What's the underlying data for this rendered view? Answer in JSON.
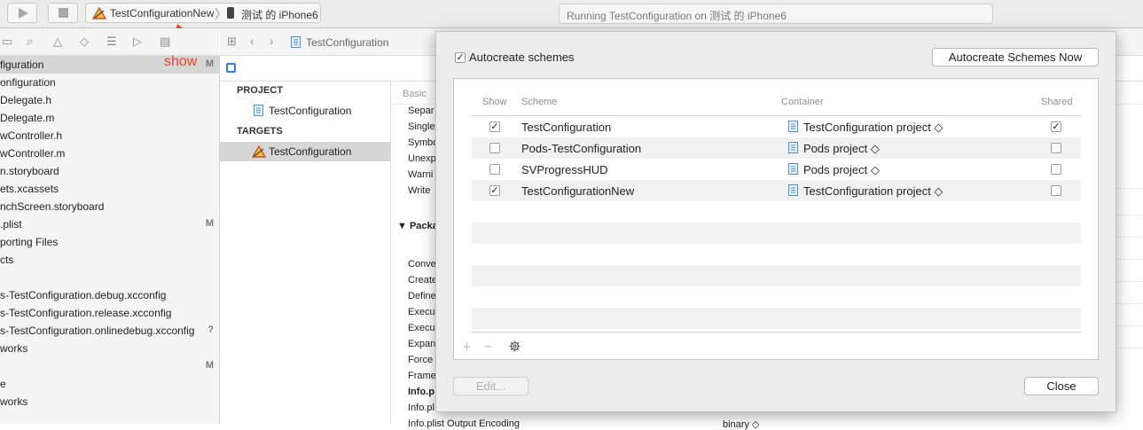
{
  "toolbar": {
    "scheme_name": "TestConfigurationNew",
    "device_name": "测试 的 iPhone6",
    "status_text": "Running TestConfiguration on 测试 的 iPhone6"
  },
  "annotation": {
    "show_label": "show",
    "color": "#e8442d"
  },
  "navigator": {
    "items": [
      {
        "label": "figuration",
        "badge": "M"
      },
      {
        "label": "onfiguration",
        "badge": ""
      },
      {
        "label": "Delegate.h",
        "badge": ""
      },
      {
        "label": "Delegate.m",
        "badge": ""
      },
      {
        "label": "wController.h",
        "badge": ""
      },
      {
        "label": "wController.m",
        "badge": ""
      },
      {
        "label": "n.storyboard",
        "badge": ""
      },
      {
        "label": "ets.xcassets",
        "badge": ""
      },
      {
        "label": "nchScreen.storyboard",
        "badge": ""
      },
      {
        "label": ".plist",
        "badge": "M"
      },
      {
        "label": "porting Files",
        "badge": ""
      },
      {
        "label": "cts",
        "badge": ""
      },
      {
        "label": "",
        "badge": ""
      },
      {
        "label": "s-TestConfiguration.debug.xcconfig",
        "badge": ""
      },
      {
        "label": "s-TestConfiguration.release.xcconfig",
        "badge": ""
      },
      {
        "label": "s-TestConfiguration.onlinedebug.xcconfig",
        "badge": "?"
      },
      {
        "label": "works",
        "badge": ""
      },
      {
        "label": "",
        "badge": "M"
      },
      {
        "label": "e",
        "badge": ""
      },
      {
        "label": "works",
        "badge": ""
      }
    ]
  },
  "jumpbar": {
    "crumb": "TestConfiguration"
  },
  "targets_panel": {
    "project_header": "PROJECT",
    "project_item": "TestConfiguration",
    "targets_header": "TARGETS",
    "target_item": "TestConfiguration"
  },
  "settings": {
    "tab_basic": "Basic",
    "rows_top": [
      "Separ",
      "Single",
      "Symbo",
      "Unexp",
      "Warni",
      "Write"
    ],
    "packaging_header": "Packa",
    "rows_bottom": [
      "Conve",
      "Create",
      "Define",
      "Execu",
      "Execu",
      "Expan",
      "Force",
      "Frame",
      "Info.p",
      "Info.pl",
      "Info.plist Output Encoding"
    ],
    "bottom_value": "binary ◇"
  },
  "dialog": {
    "autocreate_label": "Autocreate schemes",
    "autocreate_checked": true,
    "autocreate_now_label": "Autocreate Schemes Now",
    "columns": {
      "show": "Show",
      "scheme": "Scheme",
      "container": "Container",
      "shared": "Shared"
    },
    "rows": [
      {
        "show": true,
        "scheme": "TestConfiguration",
        "container": "TestConfiguration project ◇",
        "shared": true
      },
      {
        "show": false,
        "scheme": "Pods-TestConfiguration",
        "container": "Pods project ◇",
        "shared": false
      },
      {
        "show": false,
        "scheme": "SVProgressHUD",
        "container": "Pods project ◇",
        "shared": false
      },
      {
        "show": true,
        "scheme": "TestConfigurationNew",
        "container": "TestConfiguration project ◇",
        "shared": false
      }
    ],
    "add_icon": "+",
    "remove_icon": "−",
    "edit_label": "Edit...",
    "close_label": "Close"
  }
}
